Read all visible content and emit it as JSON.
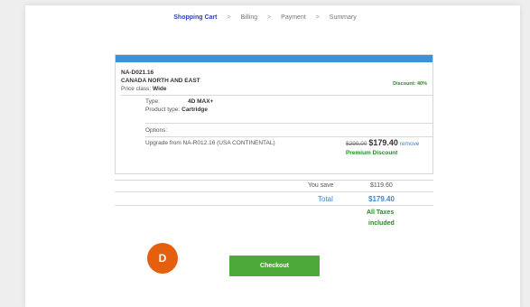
{
  "steps": {
    "shopping_cart": "Shopping Cart",
    "billing": "Billing",
    "payment": "Payment",
    "summary": "Summary",
    "separator": ">"
  },
  "item": {
    "code": "NA-D021.16",
    "region": "CANADA NORTH AND EAST",
    "price_class_label": "Price class:",
    "price_class_value": "Wide",
    "discount": "Discount: 40%",
    "type_label": "Type:",
    "type_value": "4D MAX+",
    "product_type_label": "Product type:",
    "product_type_value": "Cartridge",
    "options_label": "Options:",
    "upgrade_text": "Upgrade from NA-R012.16 (USA CONTINENTAL)",
    "old_price": "$299.00",
    "new_price": "$179.40",
    "remove_label": "remove",
    "premium_discount": "Premium Discount"
  },
  "totals": {
    "you_save_label": "You save",
    "you_save_value": "$119.60",
    "total_label": "Total",
    "total_value": "$179.40",
    "taxes_line1": "All Taxes",
    "taxes_line2": "included"
  },
  "badge_letter": "D",
  "checkout_label": "Checkout",
  "colors": {
    "accent_blue": "#3a92d8",
    "step_active": "#2b3fc4",
    "discount_green": "#1f8d1f",
    "checkout_green": "#4daa3a",
    "badge_orange": "#e4600f"
  }
}
